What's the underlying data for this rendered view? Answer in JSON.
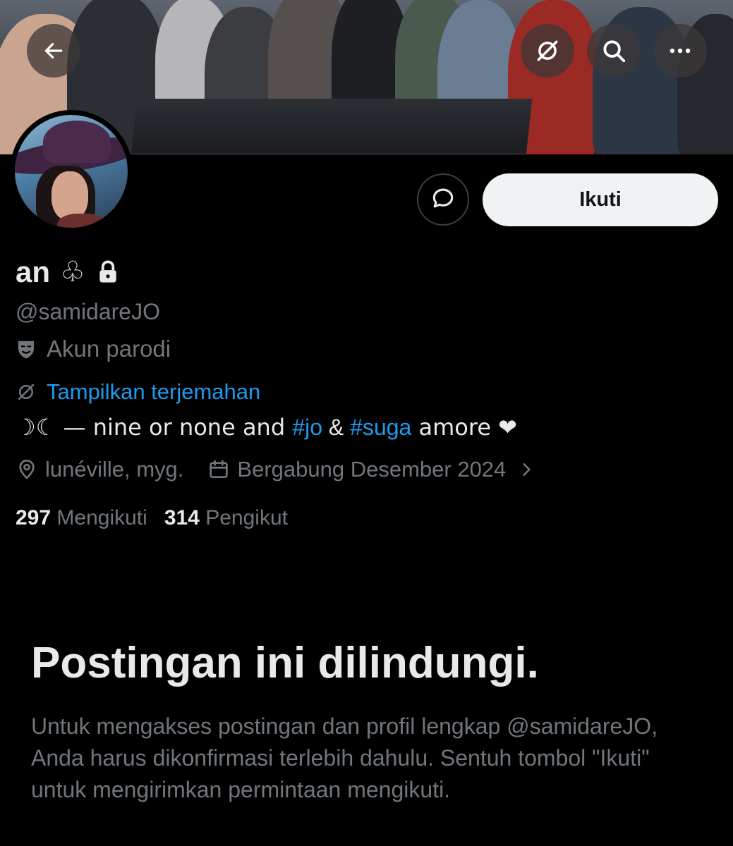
{
  "header": {
    "back_icon": "arrow-left-icon",
    "translate_icon": "translate-icon",
    "search_icon": "search-icon",
    "more_icon": "more-horizontal-icon"
  },
  "profile": {
    "name": "an",
    "name_symbol": "♧",
    "lock_icon": "lock-icon",
    "handle": "@samidareJO",
    "parody_label": "Akun parodi",
    "translate_label": "Tampilkan terjemahan",
    "bio": {
      "prefix": "☽☾ — nine or none and ",
      "tag1": "#jo",
      "mid": " & ",
      "tag2": "#suga",
      "suffix": " amore ❤"
    },
    "location": "lunéville, myg.",
    "joined": "Bergabung Desember 2024",
    "following_count": "297",
    "following_label": "Mengikuti",
    "followers_count": "314",
    "followers_label": "Pengikut"
  },
  "actions": {
    "message_icon": "message-bubble-icon",
    "follow_label": "Ikuti"
  },
  "protected": {
    "title": "Postingan ini dilindungi.",
    "description": "Untuk mengakses postingan dan profil lengkap @samidareJO, Anda harus dikonfirmasi terlebih dahulu. Sentuh tombol \"Ikuti\" untuk mengirimkan permintaan mengikuti."
  },
  "colors": {
    "background": "#000000",
    "text_primary": "#e7e9ea",
    "text_secondary": "#71767b",
    "link": "#1d9bf0",
    "button_bg": "#eff3f4"
  }
}
